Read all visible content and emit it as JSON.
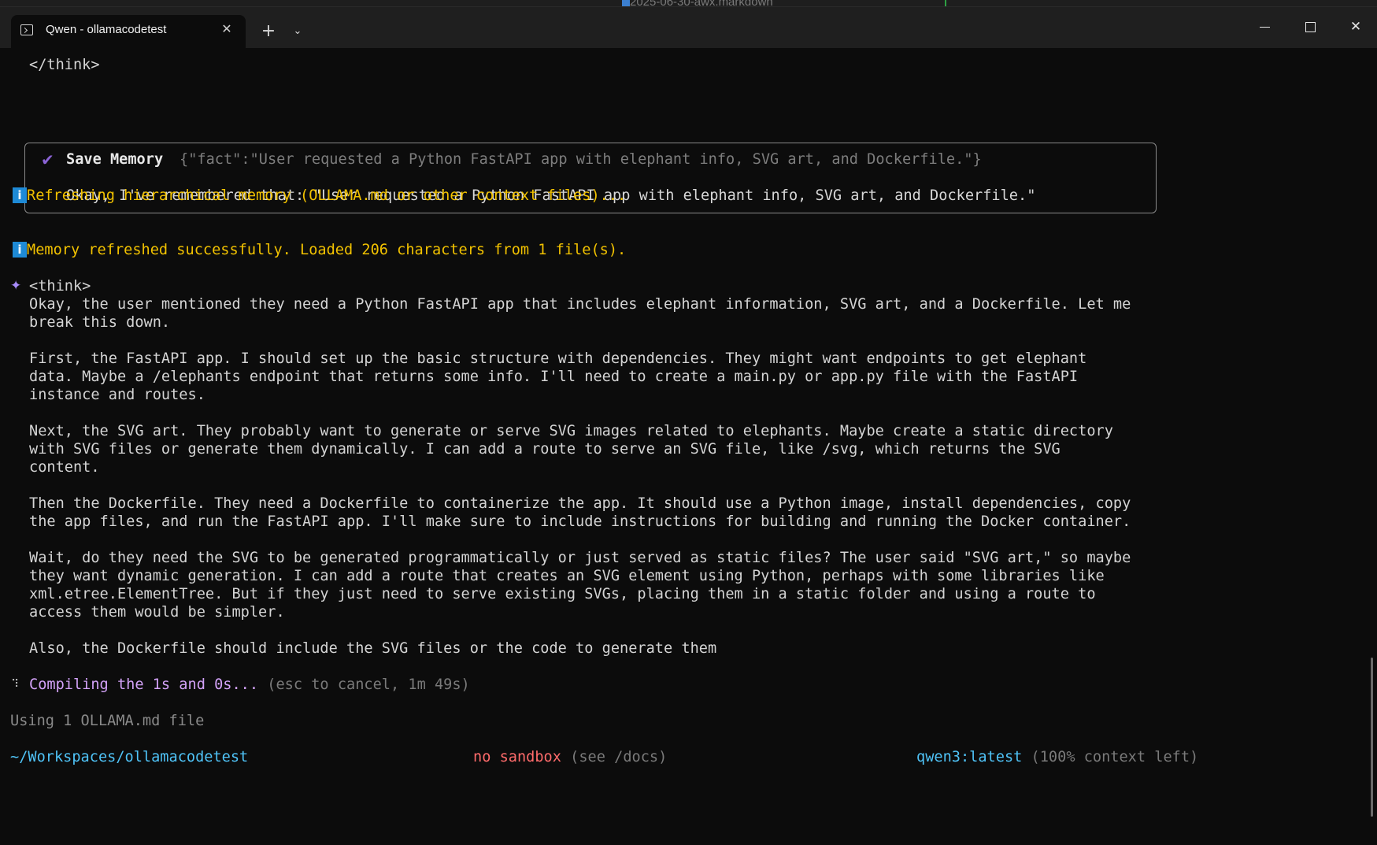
{
  "background_window": {
    "tab_title": "2025-06-30-awx.markdown"
  },
  "window": {
    "tab": {
      "title": "Qwen - ollamacodetest",
      "icon": "terminal-icon"
    },
    "controls": {
      "minimize": "minimize-icon",
      "maximize": "maximize-icon",
      "close": "close-icon"
    }
  },
  "terminal": {
    "think_close": "</think>",
    "tool_call": {
      "name": "Save Memory",
      "args": "{\"fact\":\"User requested a Python FastAPI app with elephant info, SVG art, and Dockerfile.\"}",
      "result": "Okay, I've remembered that: \"User requested a Python FastAPI app with elephant info, SVG art, and Dockerfile.\""
    },
    "info_1": "Refreshing hierarchical memory (OLLAMA.md or other context files)...",
    "info_2": "Memory refreshed successfully. Loaded 206 characters from 1 file(s).",
    "think_open": "<think>",
    "thought_lines": [
      "Okay, the user mentioned they need a Python FastAPI app that includes elephant information, SVG art, and a Dockerfile. Let me",
      "break this down.",
      "",
      "First, the FastAPI app. I should set up the basic structure with dependencies. They might want endpoints to get elephant",
      "data. Maybe a /elephants endpoint that returns some info. I'll need to create a main.py or app.py file with the FastAPI",
      "instance and routes.",
      "",
      "Next, the SVG art. They probably want to generate or serve SVG images related to elephants. Maybe create a static directory",
      "with SVG files or generate them dynamically. I can add a route to serve an SVG file, like /svg, which returns the SVG",
      "content.",
      "",
      "Then the Dockerfile. They need a Dockerfile to containerize the app. It should use a Python image, install dependencies, copy",
      "the app files, and run the FastAPI app. I'll make sure to include instructions for building and running the Docker container.",
      "",
      "Wait, do they need the SVG to be generated programmatically or just served as static files? The user said \"SVG art,\" so maybe",
      "they want dynamic generation. I can add a route that creates an SVG element using Python, perhaps with some libraries like",
      "xml.etree.ElementTree. But if they just need to serve existing SVGs, placing them in a static folder and using a route to",
      "access them would be simpler.",
      "",
      "Also, the Dockerfile should include the SVG files or the code to generate them"
    ],
    "status": {
      "message": "Compiling the 1s and 0s...",
      "hint": "(esc to cancel, 1m 49s)"
    },
    "context_note": "Using 1 OLLAMA.md file",
    "footer": {
      "path": "~/Workspaces/ollamacodetest",
      "sandbox": "no sandbox",
      "sandbox_hint": "(see /docs)",
      "model": "qwen3:latest",
      "context": "(100% context left)"
    }
  },
  "colors": {
    "info": "#f2c200",
    "accent_purple": "#d3a2f8",
    "path_cyan": "#4fc3f7",
    "sandbox_red": "#ff6b6b"
  }
}
